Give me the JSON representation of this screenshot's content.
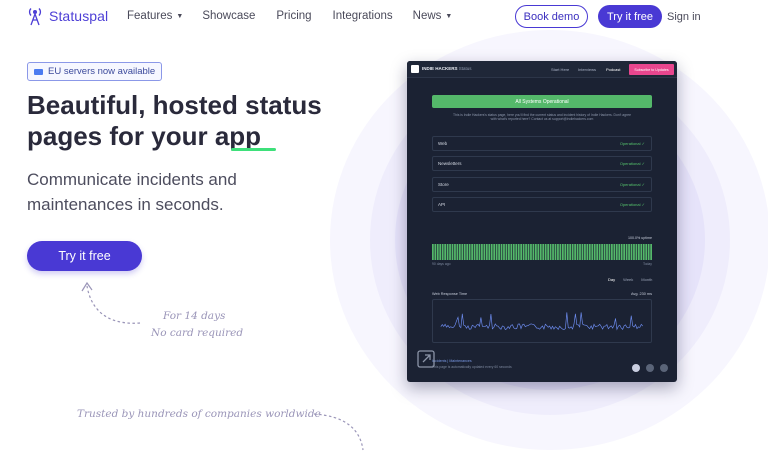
{
  "nav": {
    "brand": "Statuspal",
    "links": [
      {
        "label": "Features",
        "dropdown": true
      },
      {
        "label": "Showcase",
        "dropdown": false
      },
      {
        "label": "Pricing",
        "dropdown": false
      },
      {
        "label": "Integrations",
        "dropdown": false
      },
      {
        "label": "News",
        "dropdown": true
      }
    ],
    "book_demo": "Book demo",
    "try_free": "Try it free",
    "sign_in": "Sign in"
  },
  "hero": {
    "badge": "EU servers now available",
    "headline_line1": "Beautiful, hosted status",
    "headline_line2_pre": "pages for your ",
    "headline_line2_hl": "app",
    "subline": "Communicate incidents and maintenances in seconds.",
    "cta": "Try it free",
    "note_line1": "For 14 days",
    "note_line2": "No card required",
    "trusted": "Trusted by hundreds of companies worldwide"
  },
  "mockup": {
    "brand": "INDIE HACKERS",
    "brand_sub": "Status",
    "menu": [
      "Start Here",
      "Interviews",
      "Podcast"
    ],
    "subscribe": "Subscribe to Updates",
    "banner": "All Systems Operational",
    "description": "This is Indie Hackers's status page, here you'll find the current status and incident history of Indie Hackers. Don't agree with what's reported here? Contact us at support@indiehackers.com",
    "services": [
      {
        "name": "Web",
        "status": "Operational"
      },
      {
        "name": "Newsletters",
        "status": "Operational"
      },
      {
        "name": "Store",
        "status": "Operational"
      },
      {
        "name": "API",
        "status": "Operational"
      }
    ],
    "uptime": "100.0% uptime",
    "days_ago": "90 days ago",
    "today": "Today",
    "ranges": [
      "Day",
      "Week",
      "Month"
    ],
    "response_title": "Web Response Time",
    "avg": "Avg. 230 ms",
    "footer_link": "Incidents | Maintenances",
    "footer_note": "This page is automatically updated every 60 seconds"
  },
  "colors": {
    "accent": "#4939d4",
    "highlight": "#3ee07a",
    "operational": "#54b86a"
  }
}
